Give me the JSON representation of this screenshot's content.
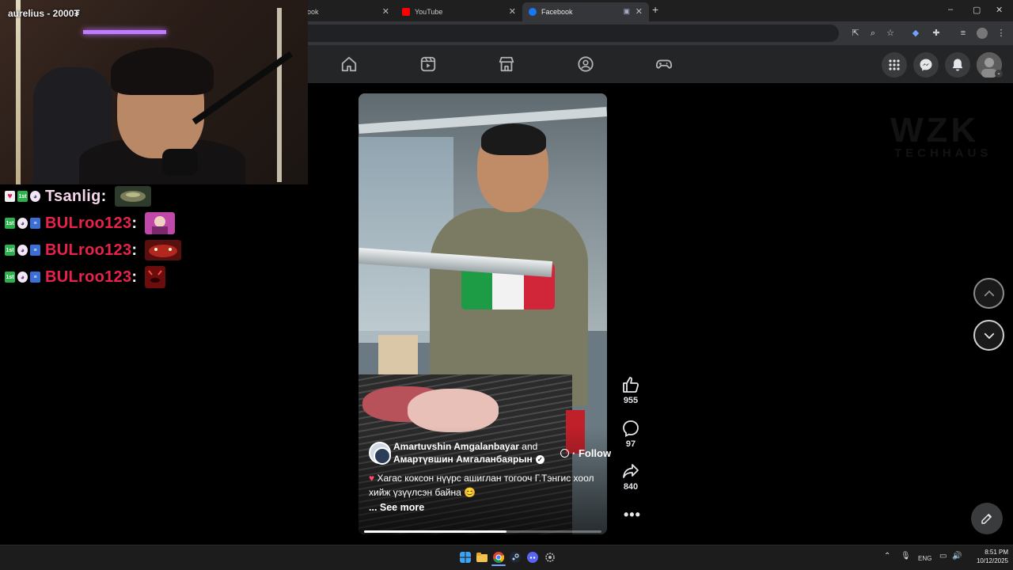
{
  "browser": {
    "tabs": [
      {
        "label": "ook",
        "active": false
      },
      {
        "label": "YouTube",
        "active": false
      },
      {
        "label": "Facebook",
        "active": true
      }
    ],
    "new_tab": "+",
    "window_controls": {
      "minimize": "–",
      "maximize": "▢",
      "close": "✕"
    }
  },
  "stream": {
    "overlay_title": "aurelius - 2000₮",
    "chat": [
      {
        "badges": [
          "heart",
          "1st",
          "mask"
        ],
        "user": "Tsanlig",
        "color": "#f5d5ea",
        "separator": ":"
      },
      {
        "badges": [
          "1st",
          "mask",
          "flag"
        ],
        "user": "BULroo123",
        "color": "#e8224a",
        "separator": ":"
      },
      {
        "badges": [
          "1st",
          "mask",
          "flag"
        ],
        "user": "BULroo123",
        "color": "#e8224a",
        "separator": ":"
      },
      {
        "badges": [
          "1st",
          "mask",
          "flag"
        ],
        "user": "BULroo123",
        "color": "#e8224a",
        "separator": ":"
      }
    ]
  },
  "facebook": {
    "nav_icons": [
      "home-icon",
      "reels-icon",
      "marketplace-icon",
      "groups-icon",
      "gaming-icon"
    ],
    "header_right": [
      "menu-grid-icon",
      "messenger-icon",
      "notifications-icon",
      "profile-avatar"
    ],
    "reel": {
      "author_primary": "Amartuvshin Amgalanbayar",
      "and_text": "and",
      "author_secondary": "Амартүвшин Амгаланбаярын",
      "follow_label": "· Follow",
      "caption": "Хагас коксон нүүрс ашиглан тогооч Г.Тэнгис хоол хийж үзүүлсэн байна",
      "caption_emoji": "😊",
      "see_more": "... See more",
      "progress": 0.6
    },
    "actions": {
      "likes": "955",
      "comments": "97",
      "shares": "840"
    },
    "watermark": {
      "main": "WZK",
      "sub": "TECHHAUS"
    }
  },
  "taskbar": {
    "language": "ENG",
    "time": "8:51 PM",
    "date": "10/12/2025"
  }
}
